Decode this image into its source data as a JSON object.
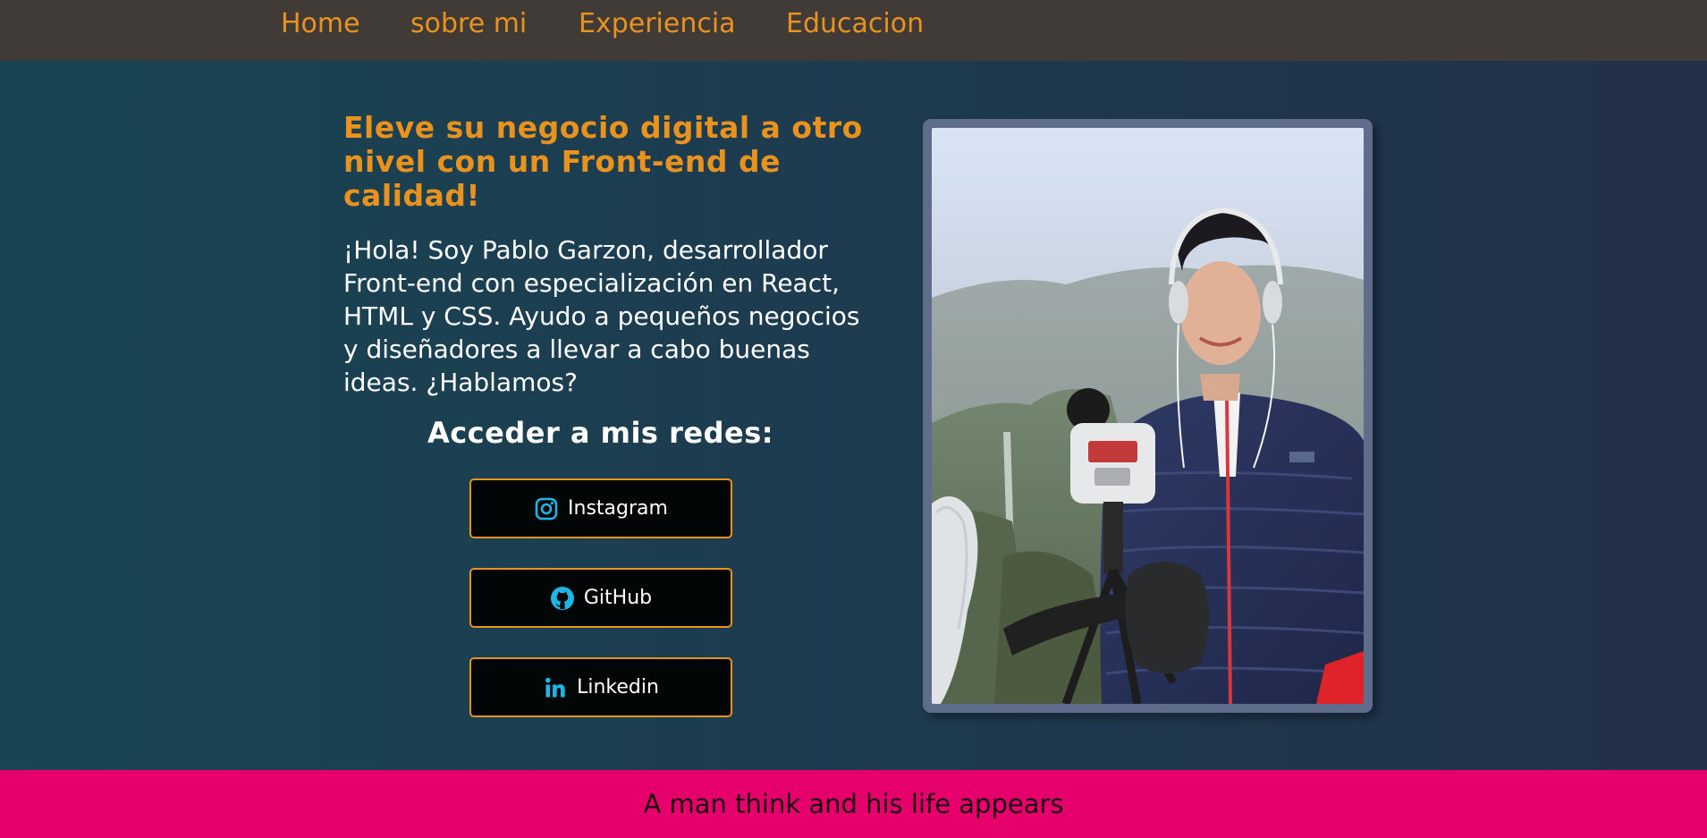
{
  "nav": {
    "items": [
      {
        "label": "Home"
      },
      {
        "label": "sobre mi"
      },
      {
        "label": "Experiencia"
      },
      {
        "label": "Educacion"
      }
    ]
  },
  "hero": {
    "headline": "Eleve su negocio digital a otro nivel con un Front-end de calidad!",
    "intro": "¡Hola! Soy Pablo Garzon, desarrollador Front-end con especialización en React, HTML y CSS. Ayudo a pequeños negocios y diseñadores a llevar a cabo buenas ideas. ¿Hablamos?",
    "social_title": "Acceder a mis redes:",
    "social": [
      {
        "label": "Instagram",
        "icon": "instagram-icon"
      },
      {
        "label": "GitHub",
        "icon": "github-icon"
      },
      {
        "label": "Linkedin",
        "icon": "linkedin-icon"
      }
    ]
  },
  "footer": {
    "quote": "A man think and his life appears"
  },
  "colors": {
    "accent": "#e9921e",
    "nav_bg": "#403b36",
    "footer_bg": "#e5006c",
    "icon": "#1fb6e6"
  }
}
